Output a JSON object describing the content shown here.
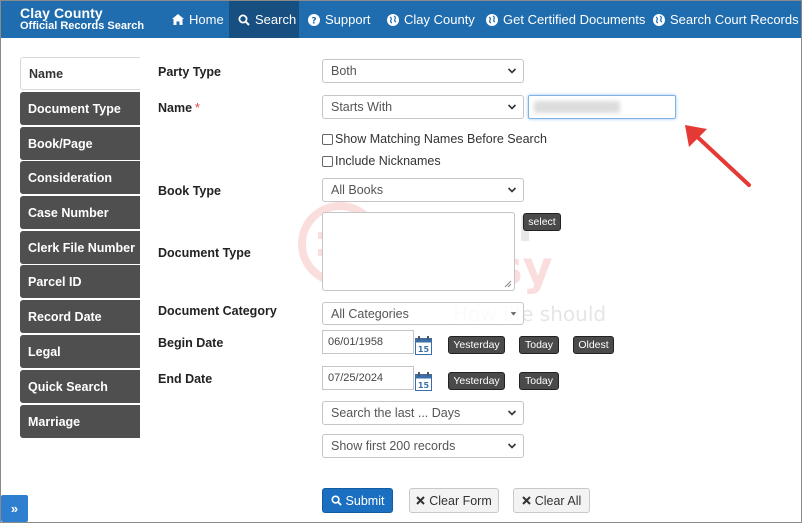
{
  "header": {
    "brand_line1": "Clay County",
    "brand_line2": "Official Records Search",
    "nav": [
      {
        "label": "Home",
        "icon": "home-icon"
      },
      {
        "label": "Search",
        "icon": "search-icon"
      },
      {
        "label": "Support",
        "icon": "question-circle-icon"
      },
      {
        "label": "Clay County",
        "icon": "globe-icon"
      },
      {
        "label": "Get Certified Documents",
        "icon": "globe-icon"
      },
      {
        "label": "Search Court Records",
        "icon": "globe-icon"
      }
    ],
    "active_nav": "Search"
  },
  "sidebar": {
    "items": [
      {
        "label": "Name"
      },
      {
        "label": "Document Type"
      },
      {
        "label": "Book/Page"
      },
      {
        "label": "Consideration"
      },
      {
        "label": "Case Number"
      },
      {
        "label": "Clerk File Number"
      },
      {
        "label": "Parcel ID"
      },
      {
        "label": "Record Date"
      },
      {
        "label": "Legal"
      },
      {
        "label": "Quick Search"
      },
      {
        "label": "Marriage"
      }
    ],
    "active": "Name",
    "expand_symbol": "»"
  },
  "form": {
    "party_type": {
      "label": "Party Type",
      "value": "Both"
    },
    "name": {
      "label": "Name",
      "required_mark": "*",
      "match_value": "Starts With",
      "input_value": ""
    },
    "show_matching_label": "Show Matching Names Before Search",
    "include_nicknames_label": "Include Nicknames",
    "book_type": {
      "label": "Book Type",
      "value": "All Books"
    },
    "select_button": "select",
    "document_type": {
      "label": "Document Type"
    },
    "document_category": {
      "label": "Document Category",
      "value": "All Categories"
    },
    "begin_date": {
      "label": "Begin Date",
      "value": "06/01/1958"
    },
    "end_date": {
      "label": "End Date",
      "value": "07/25/2024"
    },
    "calendar_day": "15",
    "yesterday_label": "Yesterday",
    "today_label": "Today",
    "oldest_label": "Oldest",
    "search_last_days": "Search the last ... Days",
    "show_records": "Show first 200 records"
  },
  "buttons": {
    "submit": "Submit",
    "clear_form": "Clear Form",
    "clear_all": "Clear All"
  },
  "watermark": {
    "line1": "super",
    "line2": "easy",
    "tagline": "How life should be"
  },
  "colors": {
    "navbar": "#1f6cae",
    "nav_active": "#174f80",
    "sidebar": "#4f4f4f",
    "primary": "#1b6fc0",
    "arrow": "#e53935"
  }
}
